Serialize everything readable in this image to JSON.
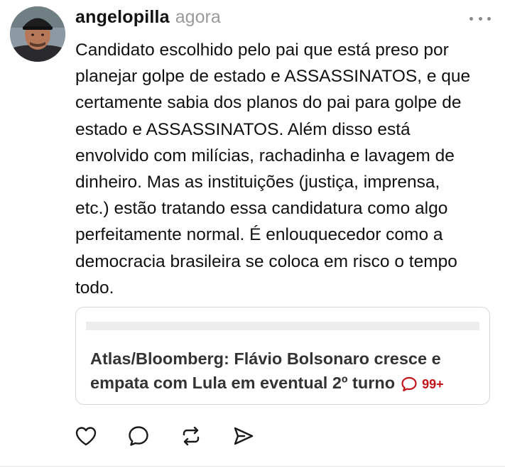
{
  "post": {
    "username": "angelopilla",
    "timestamp": "agora",
    "body_lines": [
      "Candidato escolhido pelo pai que está preso por",
      "planejar golpe de estado e ASSASSINATOS, e que",
      "certamente sabia dos planos do pai para golpe de",
      "estado e ASSASSINATOS. Além disso está",
      "envolvido com milícias, rachadinha e lavagem de",
      "dinheiro. Mas as instituições (justiça, imprensa,",
      "etc.) estão tratando essa candidatura como algo",
      "perfeitamente normal. É enlouquecedor como a",
      "democracia brasileira se coloca em risco o tempo",
      "todo."
    ]
  },
  "link_card": {
    "title_lines": [
      "Atlas/Bloomberg: Flávio Bolsonaro cresce e",
      "empata com Lula em eventual 2º turno"
    ],
    "comment_count": "99+",
    "comment_icon": "speech-bubble-icon"
  },
  "actions": [
    {
      "name": "like",
      "icon": "heart-icon"
    },
    {
      "name": "reply",
      "icon": "comment-icon"
    },
    {
      "name": "repost",
      "icon": "repost-icon"
    },
    {
      "name": "share",
      "icon": "send-icon"
    }
  ],
  "colors": {
    "text": "#111111",
    "muted": "#9a9a9a",
    "card_border": "#d6d6d6",
    "accent_red": "#c4141b"
  }
}
